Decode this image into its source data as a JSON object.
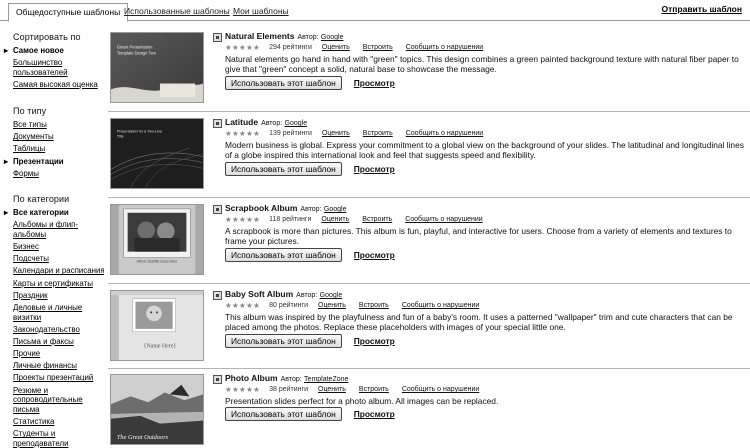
{
  "tabs": [
    {
      "label": "Общедоступные шаблоны"
    },
    {
      "label": "Использованные шаблоны"
    },
    {
      "label": "Мои шаблоны"
    }
  ],
  "report_top": "Отправить шаблон",
  "sidebar": {
    "sort": {
      "heading": "Сортировать по",
      "items": [
        {
          "label": "Самое новое",
          "selected": true
        },
        {
          "label": "Большинство пользователей"
        },
        {
          "label": "Самая высокая оценка"
        }
      ]
    },
    "type": {
      "heading": "По типу",
      "items": [
        {
          "label": "Все типы"
        },
        {
          "label": "Документы"
        },
        {
          "label": "Таблицы"
        },
        {
          "label": "Презентации",
          "selected": true
        },
        {
          "label": "Формы"
        }
      ]
    },
    "category": {
      "heading": "По категории",
      "items": [
        {
          "label": "Все категории",
          "selected": true
        },
        {
          "label": "Альбомы и флип-альбомы"
        },
        {
          "label": "Бизнес"
        },
        {
          "label": "Подсчеты"
        },
        {
          "label": "Календари и расписания"
        },
        {
          "label": "Карты и сертификаты"
        },
        {
          "label": "Праздник"
        },
        {
          "label": "Деловые и личные визитки"
        },
        {
          "label": "Законодательство"
        },
        {
          "label": "Письма и факсы"
        },
        {
          "label": "Прочие"
        },
        {
          "label": "Личные финансы"
        },
        {
          "label": "Проекты презентаций"
        },
        {
          "label": "Резюме и сопроводительные письма"
        },
        {
          "label": "Статистика"
        },
        {
          "label": "Студенты и преподаватели"
        }
      ]
    }
  },
  "common": {
    "author_label": "Автор:",
    "stars": "★★★★★",
    "rate": "Оценить",
    "embed": "Встроить",
    "report": "Сообщить о нарушении",
    "use_button": "Использовать этот шаблон",
    "preview": "Просмотр"
  },
  "templates": [
    {
      "name": "Natural Elements",
      "author": "Google",
      "ratings": "294 рейтинги",
      "description": "Natural elements go hand in hand with \"green\" topics. This design combines a green painted background texture with natural fiber paper to give that \"green\" concept a solid, natural base to showcase the message.",
      "thumb_title": "Green Presentation Template Design Two"
    },
    {
      "name": "Latitude",
      "author": "Google",
      "ratings": "139 рейтинги",
      "description": "Modern business is global. Express your commitment to a global view on the background of your slides. The latitudinal and longitudinal lines of a globe inspired this international look and feel that suggests speed and flexibility.",
      "thumb_title": "Presentation for a Two-Line Title"
    },
    {
      "name": "Scrapbook Album",
      "author": "Google",
      "ratings": "118 рейтинги",
      "description": "A scrapbook is more than pictures. This album is fun, playful, and interactive for users. Choose from a variety of elements and textures to frame your pictures.",
      "thumb_title": "Album Subtitle Goes Here"
    },
    {
      "name": "Baby Soft Album",
      "author": "Google",
      "ratings": "80 рейтинги",
      "description": "This album was inspired by the playfulness and fun of a baby's room. It uses a patterned \"wallpaper\" trim and cute characters that can be placed among the photos. Replace these placeholders with images of your special little one.",
      "thumb_title": "{Name Here}"
    },
    {
      "name": "Photo Album",
      "author": "TemplateZone",
      "ratings": "38 рейтинги",
      "description": "Presentation slides perfect for a photo album. All images can be replaced.",
      "thumb_title": "The Great Outdoors"
    }
  ]
}
